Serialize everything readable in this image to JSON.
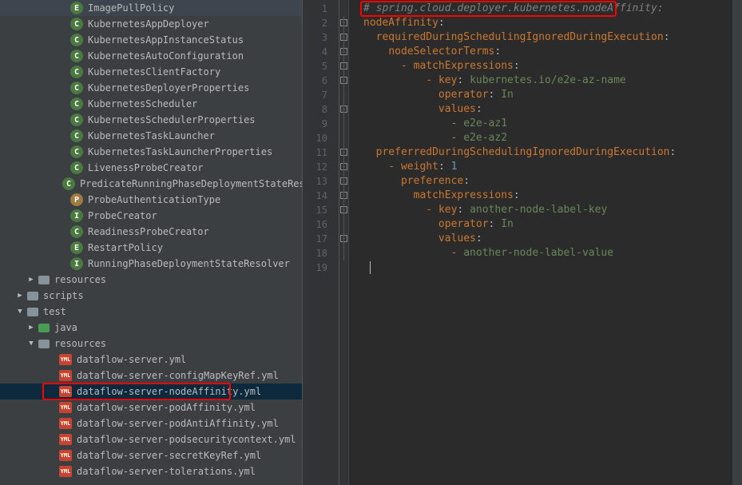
{
  "sidebar": {
    "items": [
      {
        "indent": 74,
        "icon": "E",
        "iconClass": "icon-class-e",
        "label": "ImagePullPolicy",
        "arrow": "none"
      },
      {
        "indent": 74,
        "icon": "C",
        "iconClass": "icon-class-c",
        "label": "KubernetesAppDeployer",
        "arrow": "none"
      },
      {
        "indent": 74,
        "icon": "C",
        "iconClass": "icon-class-c",
        "label": "KubernetesAppInstanceStatus",
        "arrow": "none"
      },
      {
        "indent": 74,
        "icon": "C",
        "iconClass": "icon-class-c",
        "label": "KubernetesAutoConfiguration",
        "arrow": "none"
      },
      {
        "indent": 74,
        "icon": "C",
        "iconClass": "icon-class-c",
        "label": "KubernetesClientFactory",
        "arrow": "none"
      },
      {
        "indent": 74,
        "icon": "C",
        "iconClass": "icon-class-c",
        "label": "KubernetesDeployerProperties",
        "arrow": "none"
      },
      {
        "indent": 74,
        "icon": "C",
        "iconClass": "icon-class-c",
        "label": "KubernetesScheduler",
        "arrow": "none"
      },
      {
        "indent": 74,
        "icon": "C",
        "iconClass": "icon-class-c",
        "label": "KubernetesSchedulerProperties",
        "arrow": "none"
      },
      {
        "indent": 74,
        "icon": "C",
        "iconClass": "icon-class-c",
        "label": "KubernetesTaskLauncher",
        "arrow": "none"
      },
      {
        "indent": 74,
        "icon": "C",
        "iconClass": "icon-class-c",
        "label": "KubernetesTaskLauncherProperties",
        "arrow": "none"
      },
      {
        "indent": 74,
        "icon": "C",
        "iconClass": "icon-class-c",
        "label": "LivenessProbeCreator",
        "arrow": "none"
      },
      {
        "indent": 74,
        "icon": "C",
        "iconClass": "icon-class-c",
        "label": "PredicateRunningPhaseDeploymentStateResolve",
        "arrow": "none"
      },
      {
        "indent": 74,
        "icon": "P",
        "iconClass": "icon-class-p",
        "label": "ProbeAuthenticationType",
        "arrow": "none"
      },
      {
        "indent": 74,
        "icon": "I",
        "iconClass": "icon-class-i",
        "label": "ProbeCreator",
        "arrow": "none"
      },
      {
        "indent": 74,
        "icon": "C",
        "iconClass": "icon-class-c",
        "label": "ReadinessProbeCreator",
        "arrow": "none"
      },
      {
        "indent": 74,
        "icon": "E",
        "iconClass": "icon-class-e",
        "label": "RestartPolicy",
        "arrow": "none"
      },
      {
        "indent": 74,
        "icon": "I",
        "iconClass": "icon-class-i",
        "label": "RunningPhaseDeploymentStateResolver",
        "arrow": "none"
      },
      {
        "indent": 34,
        "icon": "",
        "iconClass": "icon-folder",
        "label": "resources",
        "arrow": "collapsed"
      },
      {
        "indent": 20,
        "icon": "",
        "iconClass": "icon-folder",
        "label": "scripts",
        "arrow": "collapsed"
      },
      {
        "indent": 20,
        "icon": "",
        "iconClass": "icon-folder",
        "label": "test",
        "arrow": "expanded"
      },
      {
        "indent": 34,
        "icon": "",
        "iconClass": "icon-folder-test",
        "label": "java",
        "arrow": "collapsed"
      },
      {
        "indent": 34,
        "icon": "",
        "iconClass": "icon-folder-resources",
        "label": "resources",
        "arrow": "expanded"
      },
      {
        "indent": 60,
        "icon": "YML",
        "iconClass": "icon-yml",
        "label": "dataflow-server.yml",
        "arrow": "none"
      },
      {
        "indent": 60,
        "icon": "YML",
        "iconClass": "icon-yml",
        "label": "dataflow-server-configMapKeyRef.yml",
        "arrow": "none"
      },
      {
        "indent": 60,
        "icon": "YML",
        "iconClass": "icon-yml",
        "label": "dataflow-server-nodeAffinity.yml",
        "arrow": "none",
        "selected": true,
        "boxed": true
      },
      {
        "indent": 60,
        "icon": "YML",
        "iconClass": "icon-yml",
        "label": "dataflow-server-podAffinity.yml",
        "arrow": "none"
      },
      {
        "indent": 60,
        "icon": "YML",
        "iconClass": "icon-yml",
        "label": "dataflow-server-podAntiAffinity.yml",
        "arrow": "none"
      },
      {
        "indent": 60,
        "icon": "YML",
        "iconClass": "icon-yml",
        "label": "dataflow-server-podsecuritycontext.yml",
        "arrow": "none"
      },
      {
        "indent": 60,
        "icon": "YML",
        "iconClass": "icon-yml",
        "label": "dataflow-server-secretKeyRef.yml",
        "arrow": "none"
      },
      {
        "indent": 60,
        "icon": "YML",
        "iconClass": "icon-yml",
        "label": "dataflow-server-tolerations.yml",
        "arrow": "none"
      }
    ]
  },
  "editor": {
    "lines": [
      {
        "n": "1",
        "boxed": true,
        "tokens": [
          {
            "t": "# spring.cloud.deployer.kubernetes.nodeAffinity:",
            "c": "c-comment"
          }
        ]
      },
      {
        "n": "2",
        "tokens": [
          {
            "t": "nodeAffinity",
            "c": "c-key"
          },
          {
            "t": ":",
            "c": ""
          }
        ]
      },
      {
        "n": "3",
        "tokens": [
          {
            "t": "  ",
            "c": ""
          },
          {
            "t": "requiredDuringSchedulingIgnoredDuringExecution",
            "c": "c-key"
          },
          {
            "t": ":",
            "c": ""
          }
        ]
      },
      {
        "n": "4",
        "tokens": [
          {
            "t": "    ",
            "c": ""
          },
          {
            "t": "nodeSelectorTerms",
            "c": "c-key"
          },
          {
            "t": ":",
            "c": ""
          }
        ]
      },
      {
        "n": "5",
        "tokens": [
          {
            "t": "      ",
            "c": ""
          },
          {
            "t": "- ",
            "c": "c-dash"
          },
          {
            "t": "matchExpressions",
            "c": "c-key"
          },
          {
            "t": ":",
            "c": ""
          }
        ]
      },
      {
        "n": "6",
        "tokens": [
          {
            "t": "          ",
            "c": ""
          },
          {
            "t": "- ",
            "c": "c-dash"
          },
          {
            "t": "key",
            "c": "c-key"
          },
          {
            "t": ": ",
            "c": ""
          },
          {
            "t": "kubernetes.io/e2e-az-name",
            "c": "c-value"
          }
        ]
      },
      {
        "n": "7",
        "tokens": [
          {
            "t": "            ",
            "c": ""
          },
          {
            "t": "operator",
            "c": "c-key"
          },
          {
            "t": ": ",
            "c": ""
          },
          {
            "t": "In",
            "c": "c-value"
          }
        ]
      },
      {
        "n": "8",
        "tokens": [
          {
            "t": "            ",
            "c": ""
          },
          {
            "t": "values",
            "c": "c-key"
          },
          {
            "t": ":",
            "c": ""
          }
        ]
      },
      {
        "n": "9",
        "tokens": [
          {
            "t": "              ",
            "c": ""
          },
          {
            "t": "- ",
            "c": "c-dash"
          },
          {
            "t": "e2e-az1",
            "c": "c-value"
          }
        ]
      },
      {
        "n": "10",
        "tokens": [
          {
            "t": "              ",
            "c": ""
          },
          {
            "t": "- ",
            "c": "c-dash"
          },
          {
            "t": "e2e-az2",
            "c": "c-value"
          }
        ]
      },
      {
        "n": "11",
        "tokens": [
          {
            "t": "  ",
            "c": ""
          },
          {
            "t": "preferredDuringSchedulingIgnoredDuringExecution",
            "c": "c-key"
          },
          {
            "t": ":",
            "c": ""
          }
        ]
      },
      {
        "n": "12",
        "tokens": [
          {
            "t": "    ",
            "c": ""
          },
          {
            "t": "- ",
            "c": "c-dash"
          },
          {
            "t": "weight",
            "c": "c-key"
          },
          {
            "t": ": ",
            "c": ""
          },
          {
            "t": "1",
            "c": "c-number"
          }
        ]
      },
      {
        "n": "13",
        "tokens": [
          {
            "t": "      ",
            "c": ""
          },
          {
            "t": "preference",
            "c": "c-key"
          },
          {
            "t": ":",
            "c": ""
          }
        ]
      },
      {
        "n": "14",
        "tokens": [
          {
            "t": "        ",
            "c": ""
          },
          {
            "t": "matchExpressions",
            "c": "c-key"
          },
          {
            "t": ":",
            "c": ""
          }
        ]
      },
      {
        "n": "15",
        "tokens": [
          {
            "t": "          ",
            "c": ""
          },
          {
            "t": "- ",
            "c": "c-dash"
          },
          {
            "t": "key",
            "c": "c-key"
          },
          {
            "t": ": ",
            "c": ""
          },
          {
            "t": "another-node-label-key",
            "c": "c-value"
          }
        ]
      },
      {
        "n": "16",
        "tokens": [
          {
            "t": "            ",
            "c": ""
          },
          {
            "t": "operator",
            "c": "c-key"
          },
          {
            "t": ": ",
            "c": ""
          },
          {
            "t": "In",
            "c": "c-value"
          }
        ]
      },
      {
        "n": "17",
        "tokens": [
          {
            "t": "            ",
            "c": ""
          },
          {
            "t": "values",
            "c": "c-key"
          },
          {
            "t": ":",
            "c": ""
          }
        ]
      },
      {
        "n": "18",
        "tokens": [
          {
            "t": "              ",
            "c": ""
          },
          {
            "t": "- ",
            "c": "c-dash"
          },
          {
            "t": "another-node-label-value",
            "c": "c-value"
          }
        ]
      },
      {
        "n": "19",
        "tokens": [],
        "cursor": true
      }
    ]
  }
}
